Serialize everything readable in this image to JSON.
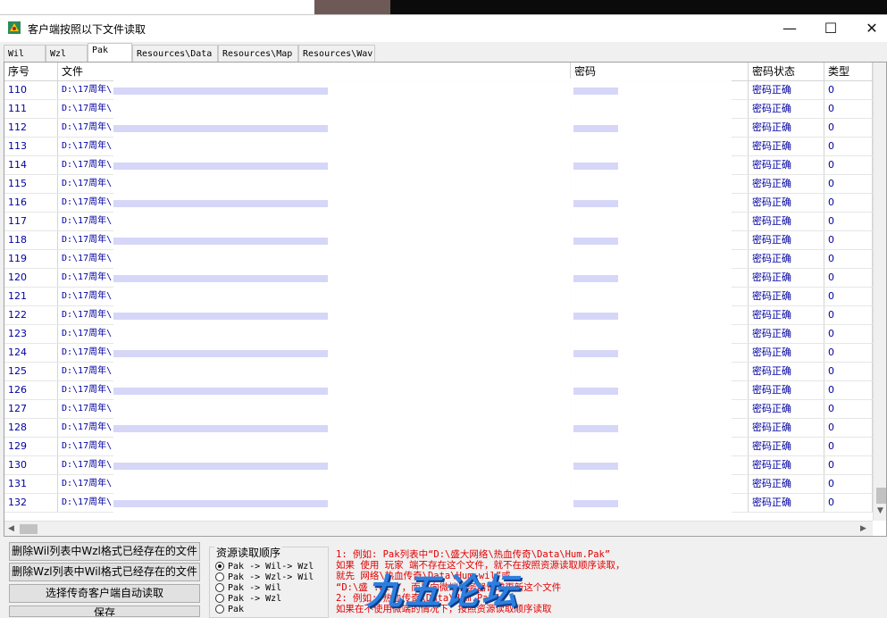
{
  "window": {
    "title": "客户端按照以下文件读取",
    "minimize": "—",
    "maximize": "☐",
    "close": "✕"
  },
  "tabs": [
    "Wil",
    "Wzl",
    "Pak",
    "Resources\\Data",
    "Resources\\Map",
    "Resources\\Wav"
  ],
  "active_tab": "Pak",
  "table": {
    "headers": [
      "序号",
      "文件",
      "密码",
      "密码状态",
      "类型"
    ],
    "rows": [
      {
        "no": "110",
        "file": "D:\\17周年\\",
        "status": "密码正确",
        "type": "0"
      },
      {
        "no": "111",
        "file": "D:\\17周年\\",
        "status": "密码正确",
        "type": "0"
      },
      {
        "no": "112",
        "file": "D:\\17周年\\",
        "status": "密码正确",
        "type": "0"
      },
      {
        "no": "113",
        "file": "D:\\17周年\\",
        "status": "密码正确",
        "type": "0"
      },
      {
        "no": "114",
        "file": "D:\\17周年\\",
        "status": "密码正确",
        "type": "0"
      },
      {
        "no": "115",
        "file": "D:\\17周年\\",
        "status": "密码正确",
        "type": "0"
      },
      {
        "no": "116",
        "file": "D:\\17周年\\",
        "status": "密码正确",
        "type": "0"
      },
      {
        "no": "117",
        "file": "D:\\17周年\\",
        "status": "密码正确",
        "type": "0"
      },
      {
        "no": "118",
        "file": "D:\\17周年\\",
        "status": "密码正确",
        "type": "0"
      },
      {
        "no": "119",
        "file": "D:\\17周年\\",
        "status": "密码正确",
        "type": "0"
      },
      {
        "no": "120",
        "file": "D:\\17周年\\",
        "status": "密码正确",
        "type": "0"
      },
      {
        "no": "121",
        "file": "D:\\17周年\\",
        "status": "密码正确",
        "type": "0"
      },
      {
        "no": "122",
        "file": "D:\\17周年\\",
        "status": "密码正确",
        "type": "0"
      },
      {
        "no": "123",
        "file": "D:\\17周年\\",
        "status": "密码正确",
        "type": "0"
      },
      {
        "no": "124",
        "file": "D:\\17周年\\",
        "status": "密码正确",
        "type": "0"
      },
      {
        "no": "125",
        "file": "D:\\17周年\\",
        "status": "密码正确",
        "type": "0"
      },
      {
        "no": "126",
        "file": "D:\\17周年\\",
        "status": "密码正确",
        "type": "0"
      },
      {
        "no": "127",
        "file": "D:\\17周年\\",
        "status": "密码正确",
        "type": "0"
      },
      {
        "no": "128",
        "file": "D:\\17周年\\",
        "status": "密码正确",
        "type": "0"
      },
      {
        "no": "129",
        "file": "D:\\17周年\\",
        "status": "密码正确",
        "type": "0"
      },
      {
        "no": "130",
        "file": "D:\\17周年\\",
        "status": "密码正确",
        "type": "0"
      },
      {
        "no": "131",
        "file": "D:\\17周年\\",
        "status": "密码正确",
        "type": "0"
      },
      {
        "no": "132",
        "file": "D:\\17周年\\",
        "status": "密码正确",
        "type": "0"
      }
    ]
  },
  "buttons": {
    "delete_wil": "删除Wil列表中Wzl格式已经存在的文件",
    "delete_wzl": "删除Wzl列表中Wil格式已经存在的文件",
    "auto_read": "选择传奇客户端自动读取",
    "save": "保存"
  },
  "load_order": {
    "title": "资源读取顺序",
    "options": [
      "Pak -> Wil-> Wzl",
      "Pak -> Wzl-> Wil",
      "Pak -> Wil",
      "Pak -> Wzl",
      "Pak"
    ],
    "selected": 0
  },
  "notes": [
    "1: 例如: Pak列表中“D:\\盛大网络\\热血传奇\\Data\\Hum.Pak”",
    "   如果  使用  玩家   端不存在这个文件，就不在按照资源读取顺序读取，",
    "   就先                  网络\\热血传奇\\Data\\Hum.wil”或",
    "   “D:\\盛                       .wzl”，而是向微端服务器请求更新这个文件",
    "2:  例如:               热血传奇\\Data\\Hum.Pak”",
    "   如果在不使用微端的情况下，按照资源读取顺序读取"
  ],
  "watermark": "九五论坛",
  "colors": {
    "row_text": "#0000a0",
    "note_text": "#e00000",
    "blur_overlay": "#b5b5f2"
  }
}
